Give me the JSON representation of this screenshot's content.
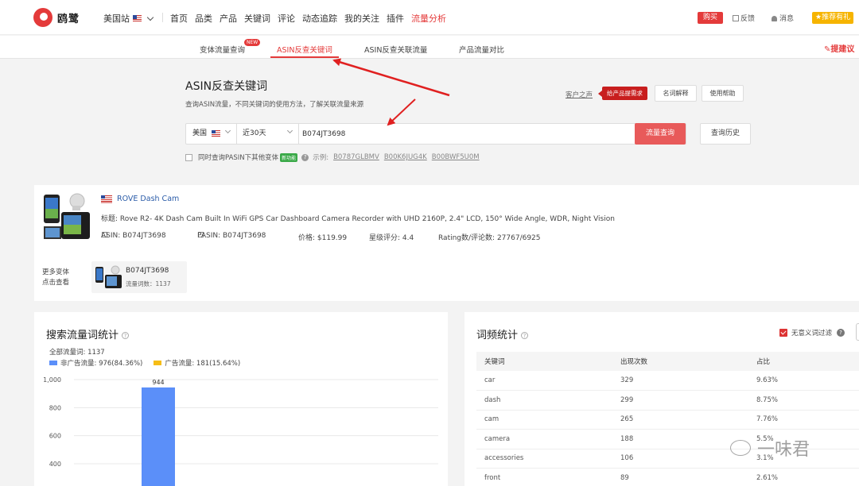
{
  "app": {
    "logo_text": "鸥鹭",
    "site": "美国站",
    "nav": [
      "首页",
      "品类",
      "产品",
      "关键词",
      "评论",
      "动态追踪",
      "我的关注",
      "插件",
      "流量分析"
    ],
    "buy": "购买",
    "feedback": "反馈",
    "messages": "消息",
    "recommend": "推荐有礼"
  },
  "subtabs": {
    "items": [
      "变体流量查询",
      "ASIN反查关键词",
      "ASIN反查关联流量",
      "产品流量对比"
    ],
    "new_badge": "NEW",
    "suggest": "提建议"
  },
  "search": {
    "title": "ASIN反查关键词",
    "subtitle": "查询ASIN流量，不同关键词的使用方法，了解关联流量来源",
    "voice": "客户之声",
    "request_btn": "给产品提需求",
    "glossary_btn": "名词解释",
    "help_btn": "使用帮助",
    "country": "美国",
    "period": "近30天",
    "asin_value": "B074JT3698",
    "query_btn": "流量查询",
    "history_btn": "查询历史",
    "pasin_option": "同时查询PASIN下其他变体",
    "new_feature": "新功能",
    "example_label": "示例:",
    "examples": [
      "B0787GLBMV",
      "B00K6JUG4K",
      "B00BWF5U0M"
    ]
  },
  "product": {
    "brand": "ROVE Dash Cam",
    "title": "标题:   Rove R2- 4K Dash Cam Built In WiFi GPS Car Dashboard Camera Recorder with UHD 2160P, 2.4\" LCD, 150° Wide Angle, WDR, Night Vision",
    "asin": "ASIN: B074JT3698",
    "pasin": "PASIN: B074JT3698",
    "price": "价格: $119.99",
    "rating": "星级评分: 4.4",
    "rating_counts": "Rating数/评论数: 27767/6925",
    "variants_label_1": "更多变体",
    "variants_label_2": "点击查看",
    "variant_asin": "B074JT3698",
    "variant_count": "流量词数：1137"
  },
  "stats": {
    "title": "搜索流量词统计",
    "total": "全部流量词: 1137",
    "legend_organic": "非广告流量: 976(84.36%)",
    "legend_ad": "广告流量: 181(15.64%)",
    "colors": {
      "organic": "#5b8ff9",
      "ad": "#f6bd16"
    }
  },
  "chart_data": {
    "type": "bar",
    "categories": [
      ""
    ],
    "series": [
      {
        "name": "非广告流量",
        "values": [
          944
        ]
      }
    ],
    "data_labels": [
      "944"
    ],
    "ytick_labels": [
      "1,000",
      "800",
      "600",
      "400"
    ],
    "ylim": [
      0,
      1000
    ],
    "grid": true
  },
  "wordfreq": {
    "title": "词频统计",
    "filter_label": "无意义词过滤",
    "headers": [
      "关键词",
      "出现次数",
      "占比"
    ],
    "rows": [
      [
        "car",
        "329",
        "9.63%"
      ],
      [
        "dash",
        "299",
        "8.75%"
      ],
      [
        "cam",
        "265",
        "7.76%"
      ],
      [
        "camera",
        "188",
        "5.5%"
      ],
      [
        "accessories",
        "106",
        "3.1%"
      ],
      [
        "front",
        "89",
        "2.61%"
      ]
    ]
  },
  "watermark": "一味君"
}
